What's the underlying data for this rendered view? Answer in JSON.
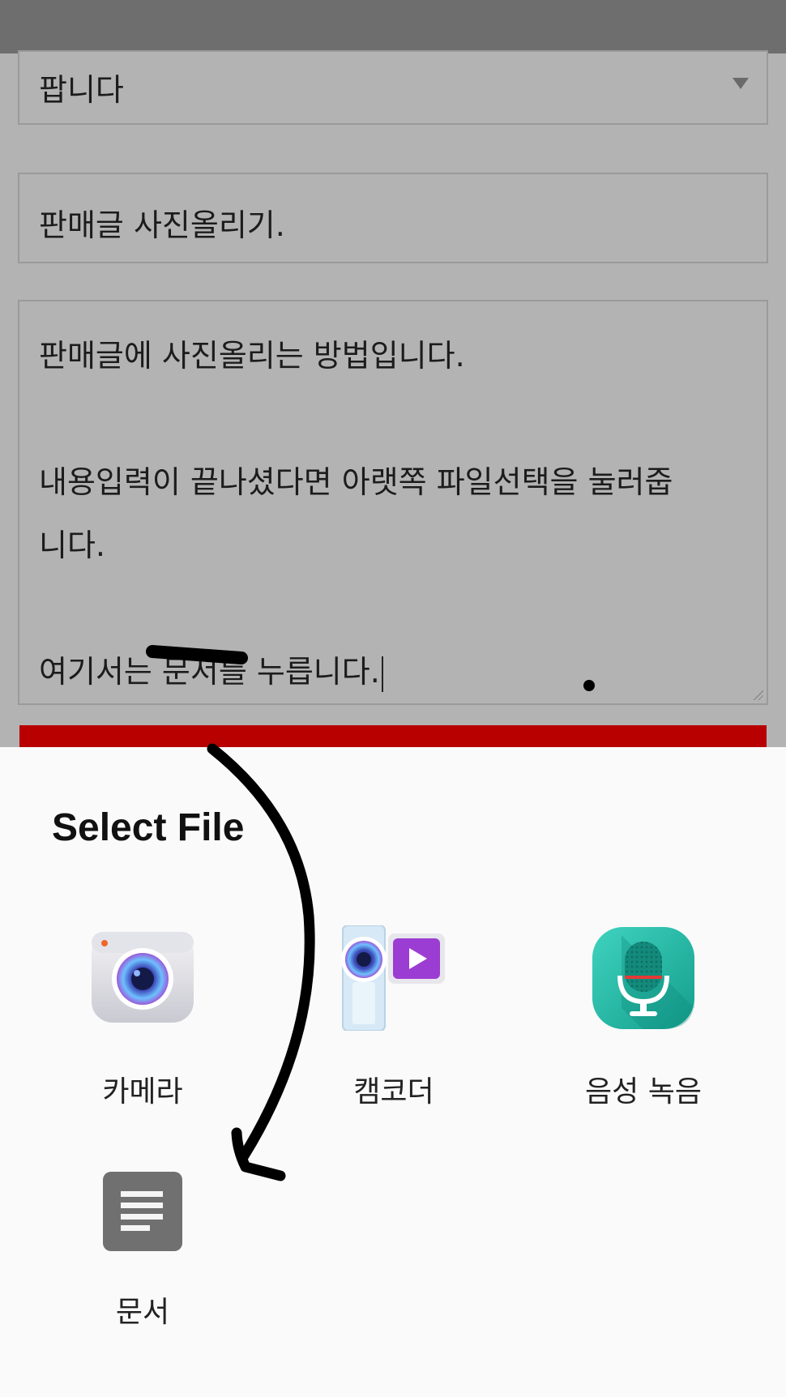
{
  "form": {
    "category_value": "팝니다",
    "title_value": "판매글 사진올리기.",
    "content_value": "판매글에 사진올리는 방법입니다.\n\n내용입력이 끝나셨다면 아랫쪽 파일선택을 눌러줍\n니다.\n\n여기서는 문서를 누릅니다."
  },
  "colors": {
    "submit_button": "#b80000",
    "dim_overlay": "#b3b3b3",
    "sheet_background": "#fafafa"
  },
  "sheet": {
    "title": "Select File",
    "apps": [
      {
        "label": "카메라",
        "icon": "camera-icon"
      },
      {
        "label": "캠코더",
        "icon": "camcorder-icon"
      },
      {
        "label": "음성 녹음",
        "icon": "voice-recorder-icon"
      },
      {
        "label": "문서",
        "icon": "document-icon"
      }
    ]
  }
}
